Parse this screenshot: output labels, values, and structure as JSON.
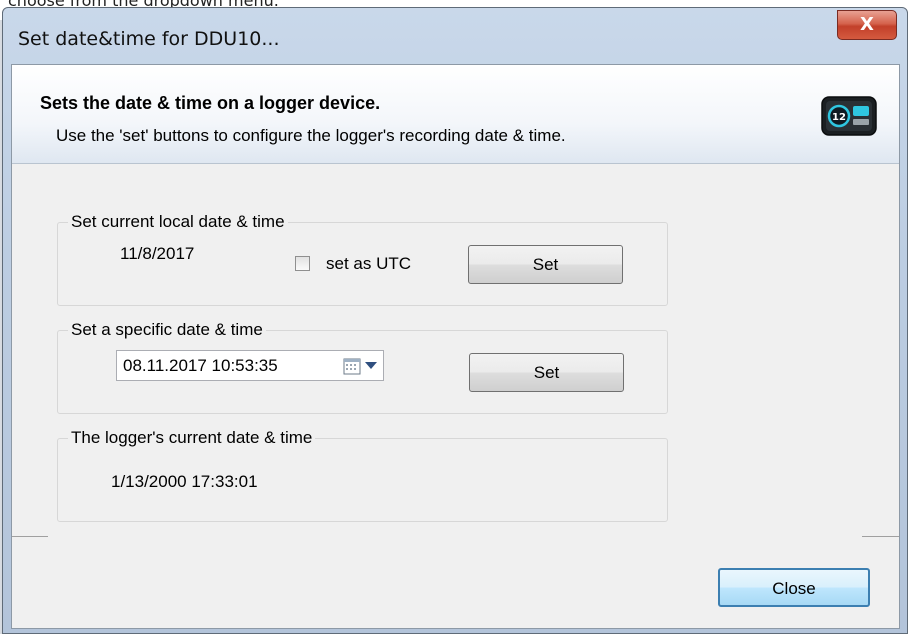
{
  "background": {
    "caption": "choose from the dropdown menu."
  },
  "window": {
    "title": "Set date&time for DDU10...",
    "close_label": "X"
  },
  "header": {
    "title": "Sets the date & time on a logger device.",
    "subtitle": "Use the 'set' buttons to configure the logger's recording date & time.",
    "icon": "logger-device-icon"
  },
  "group_local": {
    "title": "Set current local date & time",
    "date": "11/8/2017",
    "utc_label": "set as UTC",
    "utc_checked": false,
    "set_label": "Set"
  },
  "group_specific": {
    "title": "Set a specific date & time",
    "datetime_value": "08.11.2017 10:53:35",
    "set_label": "Set"
  },
  "group_logger": {
    "title": "The logger's current date & time",
    "value": "1/13/2000 17:33:01"
  },
  "footer": {
    "close_label": "Close"
  },
  "colors": {
    "accent": "#3c7fb1",
    "close_red": "#c2402a",
    "panel": "#f0f0f0"
  }
}
